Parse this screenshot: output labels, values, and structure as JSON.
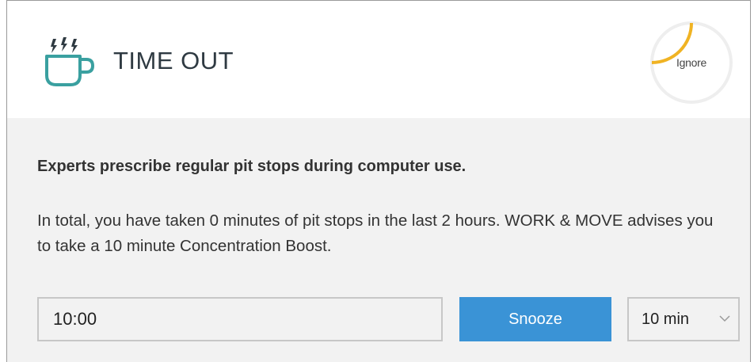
{
  "header": {
    "title": "TIME OUT",
    "ignore_label": "Ignore",
    "ignore_countdown_progress": 0.25,
    "accent_color": "#f0b323",
    "icon_color": "#3aa0a0"
  },
  "message": {
    "headline": "Experts prescribe regular pit stops during computer use.",
    "body": "In total, you have taken 0 minutes of pit stops in the last 2 hours. WORK & MOVE advises you to take a 10 minute Concentration Boost."
  },
  "controls": {
    "timer_value": "10:00",
    "snooze_label": "Snooze",
    "snooze_color": "#3a93d6",
    "duration_selected": "10 min"
  }
}
